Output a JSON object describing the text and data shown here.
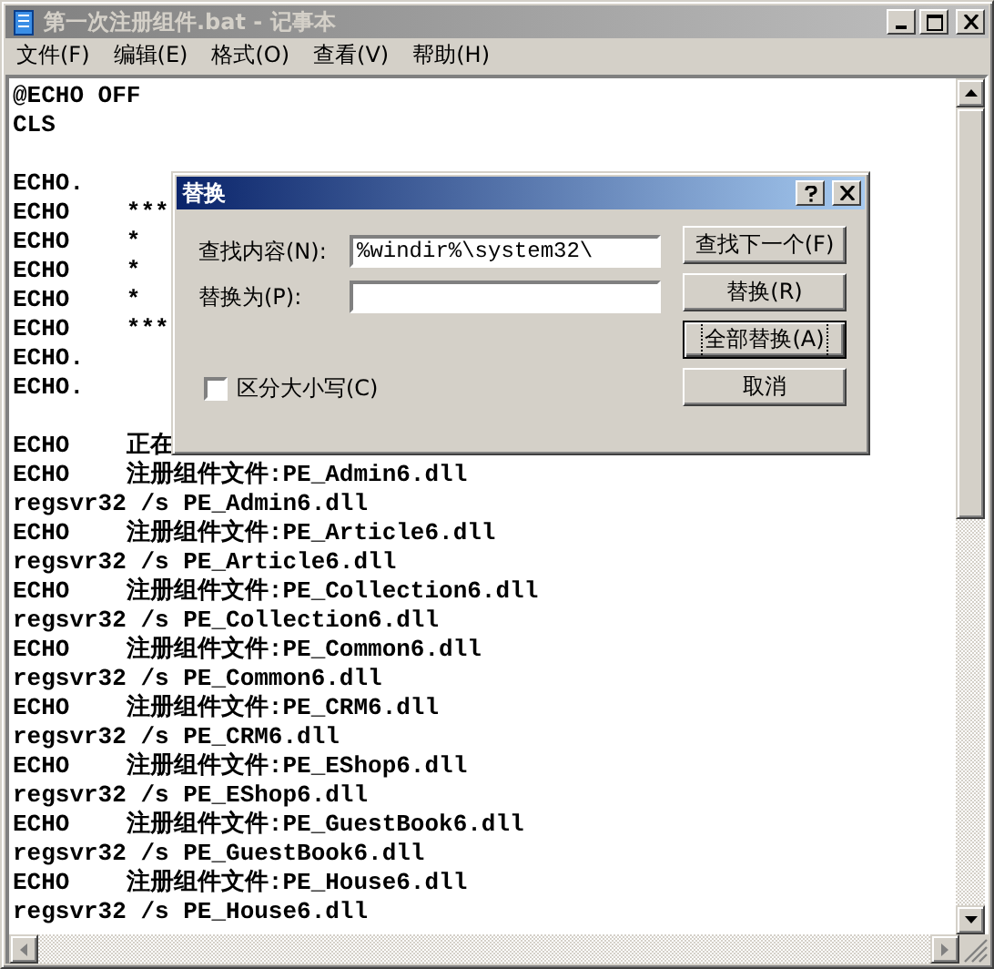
{
  "window": {
    "title": "第一次注册组件.bat - 记事本",
    "active": false
  },
  "menu": [
    "文件(F)",
    "编辑(E)",
    "格式(O)",
    "查看(V)",
    "帮助(H)"
  ],
  "editor": {
    "blocks": [
      [
        "@ECHO OFF",
        "CLS"
      ],
      [
        "ECHO.",
        "ECHO    ***",
        "ECHO    *",
        "ECHO    *",
        "ECHO    *",
        "ECHO    ***",
        "ECHO.",
        "ECHO."
      ],
      [
        "ECHO    正在",
        "ECHO    注册组件文件:PE_Admin6.dll",
        "regsvr32 /s PE_Admin6.dll",
        "ECHO    注册组件文件:PE_Article6.dll",
        "regsvr32 /s PE_Article6.dll",
        "ECHO    注册组件文件:PE_Collection6.dll",
        "regsvr32 /s PE_Collection6.dll",
        "ECHO    注册组件文件:PE_Common6.dll",
        "regsvr32 /s PE_Common6.dll",
        "ECHO    注册组件文件:PE_CRM6.dll",
        "regsvr32 /s PE_CRM6.dll",
        "ECHO    注册组件文件:PE_EShop6.dll",
        "regsvr32 /s PE_EShop6.dll",
        "ECHO    注册组件文件:PE_GuestBook6.dll",
        "regsvr32 /s PE_GuestBook6.dll",
        "ECHO    注册组件文件:PE_House6.dll",
        "regsvr32 /s PE_House6.dll"
      ]
    ]
  },
  "dialog": {
    "title": "替换",
    "active": true,
    "fields": [
      {
        "label": "查找内容(N):",
        "value": "%windir%\\system32\\"
      },
      {
        "label": "替换为(P):"
      }
    ],
    "checkbox": {
      "label": "区分大小写(C)",
      "checked": false
    },
    "buttons": [
      {
        "label": "查找下一个(F)",
        "default": false
      },
      {
        "label": "替换(R)",
        "default": false
      },
      {
        "label": "全部替换(A)",
        "default": true
      },
      {
        "label": "取消",
        "default": false
      }
    ]
  }
}
